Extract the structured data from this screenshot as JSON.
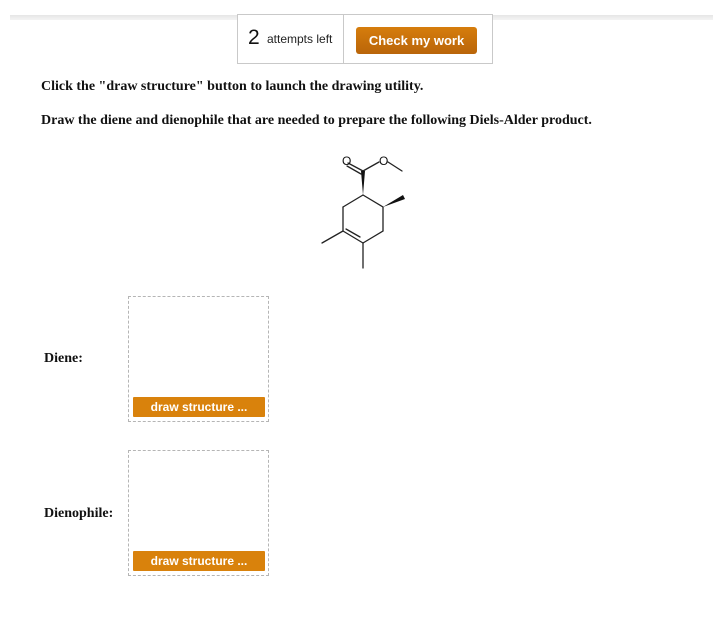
{
  "header": {
    "attempts_count": "2",
    "attempts_text": "attempts left",
    "check_button_label": "Check my work"
  },
  "instructions": {
    "line1": "Click the \"draw structure\" button to launch the drawing utility.",
    "line2": "Draw the diene and dienophile that are needed to prepare the following Diels-Alder product."
  },
  "molecule": {
    "atom_labels": [
      "O",
      "O"
    ]
  },
  "fields": {
    "diene": {
      "label": "Diene:",
      "button_label": "draw structure ..."
    },
    "dienophile": {
      "label": "Dienophile:",
      "button_label": "draw structure ..."
    }
  },
  "colors": {
    "accent": "#d9820c",
    "check_button": "#c8700b",
    "box_border": "#b5b5b5"
  }
}
